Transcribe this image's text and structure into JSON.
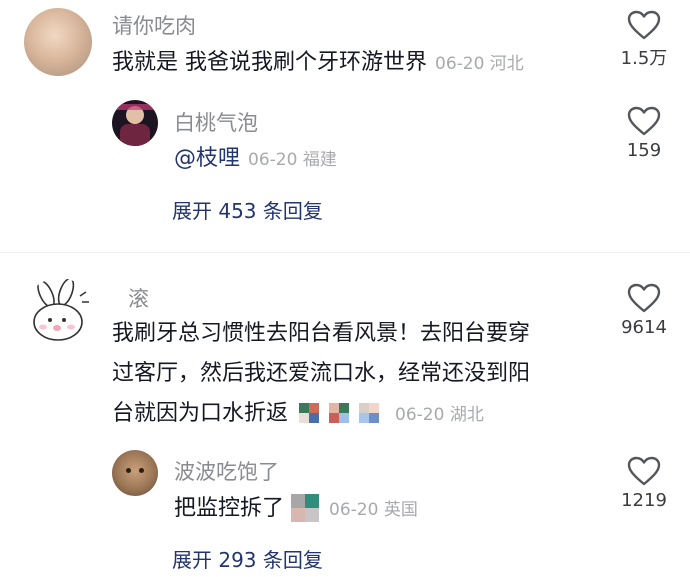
{
  "comments": [
    {
      "user": "请你吃肉",
      "text": "我就是 我爸说我刷个牙环游世界",
      "meta": "06-20 河北",
      "likes": "1.5万",
      "reply": {
        "user": "白桃气泡",
        "mention": "@枝哩",
        "meta": "06-20 福建",
        "likes": "159"
      },
      "expand_label": "展开 453 条回复"
    },
    {
      "user": "滚",
      "text_lines": [
        "我刷牙总习惯性去阳台看风景！去阳台要穿",
        "过客厅，然后我还爱流口水，经常还没到阳",
        "台就因为口水折返"
      ],
      "meta": "06-20 湖北",
      "likes": "9614",
      "reply": {
        "user": "波波吃饱了",
        "text": "把监控拆了",
        "meta": "06-20 英国",
        "likes": "1219"
      },
      "expand_label": "展开 293 条回复"
    }
  ]
}
